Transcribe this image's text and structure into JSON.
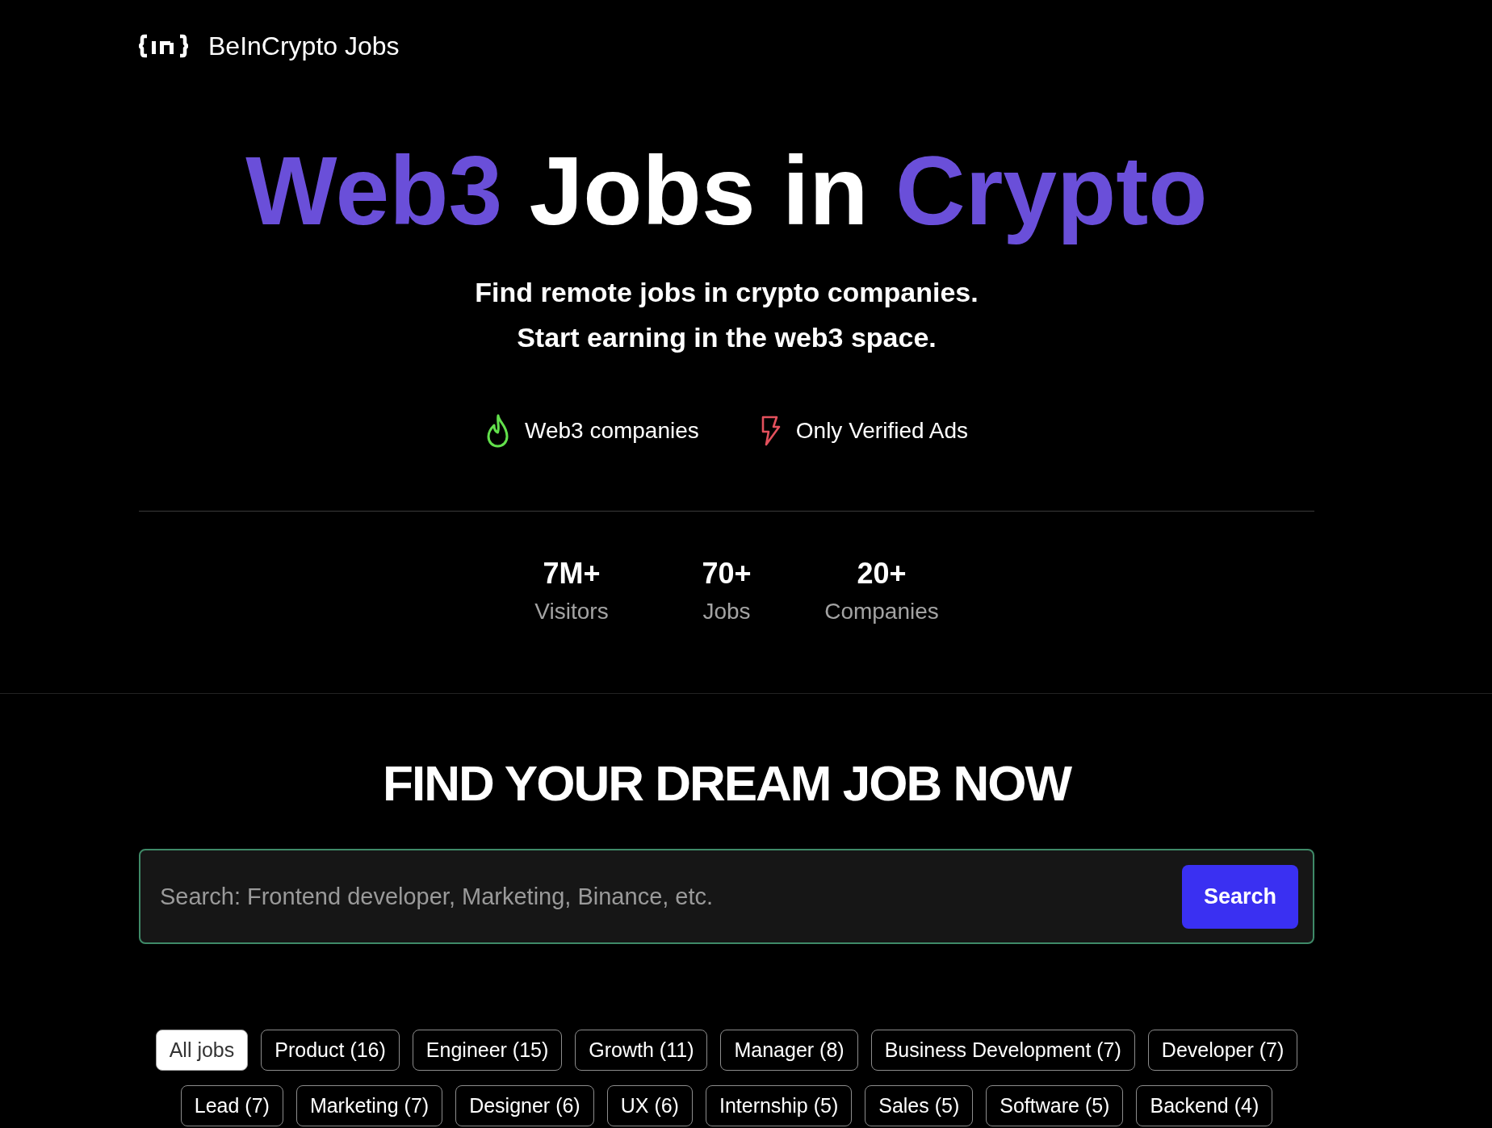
{
  "header": {
    "logo_text": "BeInCrypto Jobs"
  },
  "hero": {
    "headline": [
      {
        "text": "Web3",
        "accent": true
      },
      {
        "text": "Jobs in",
        "accent": false
      },
      {
        "text": "Crypto",
        "accent": true
      }
    ],
    "tagline": [
      "Find remote jobs in crypto companies.",
      "Start earning in the web3 space."
    ],
    "features": [
      {
        "kind": "flame",
        "label": "Web3 companies"
      },
      {
        "kind": "bolt",
        "label": "Only Verified Ads"
      }
    ]
  },
  "stats": [
    {
      "value": "7M+",
      "label": "Visitors"
    },
    {
      "value": "70+",
      "label": "Jobs"
    },
    {
      "value": "20+",
      "label": "Companies"
    }
  ],
  "job_search": {
    "title": "FIND YOUR DREAM JOB NOW",
    "search": {
      "placeholder": "Search: Frontend developer, Marketing, Binance, etc.",
      "button": "Search"
    },
    "filters": [
      {
        "label": "All jobs",
        "selected": true
      },
      {
        "label": "Product (16)",
        "selected": false
      },
      {
        "label": "Engineer (15)",
        "selected": false
      },
      {
        "label": "Growth (11)",
        "selected": false
      },
      {
        "label": "Manager (8)",
        "selected": false
      },
      {
        "label": "Business Development (7)",
        "selected": false
      },
      {
        "label": "Developer (7)",
        "selected": false
      },
      {
        "label": "Lead (7)",
        "selected": false
      },
      {
        "label": "Marketing (7)",
        "selected": false
      },
      {
        "label": "Designer (6)",
        "selected": false
      },
      {
        "label": "UX (6)",
        "selected": false
      },
      {
        "label": "Internship (5)",
        "selected": false
      },
      {
        "label": "Sales (5)",
        "selected": false
      },
      {
        "label": "Software (5)",
        "selected": false
      },
      {
        "label": "Backend (4)",
        "selected": false
      }
    ]
  }
}
